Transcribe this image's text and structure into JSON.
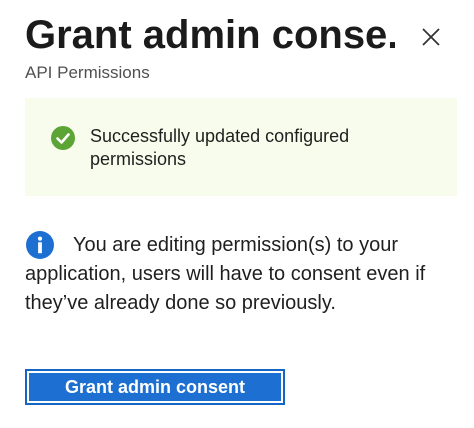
{
  "dialog": {
    "title": "Grant admin conse...",
    "subtitle": "API Permissions",
    "close_icon": "close-icon"
  },
  "success_banner": {
    "icon": "check-circle-icon",
    "icon_color": "#5ca436",
    "text": "Successfully updated configured permissions"
  },
  "info_message": {
    "icon": "info-icon",
    "icon_color": "#1d6fd1",
    "text": "You are editing permission(s) to your application, users will have to consent even if they’ve already done so previously."
  },
  "actions": {
    "grant_label": "Grant admin consent",
    "accent_color": "#1d6fd1"
  }
}
